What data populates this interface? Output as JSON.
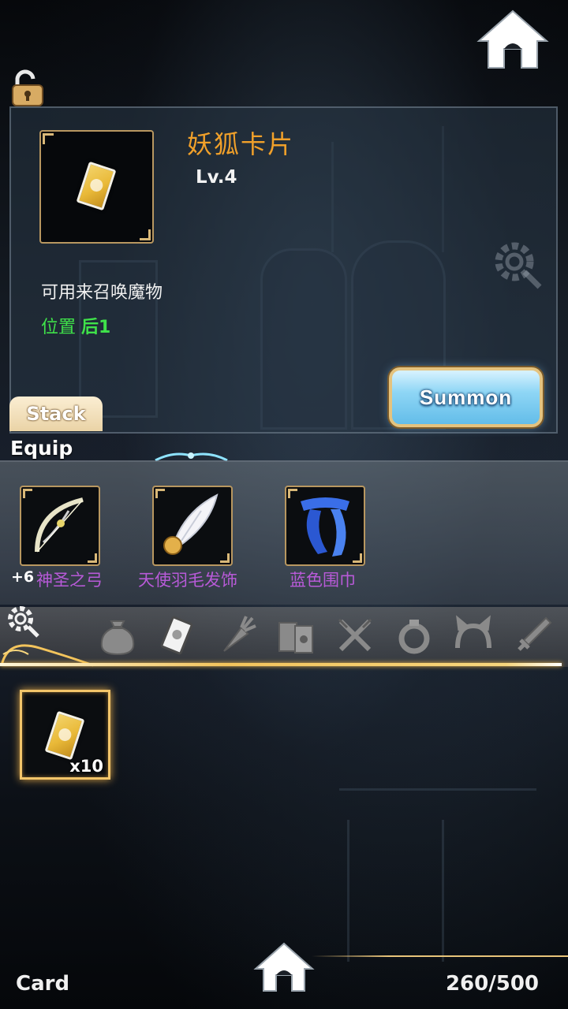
{
  "item": {
    "name": "妖狐卡片",
    "level": "Lv.4",
    "description": "可用来召唤魔物",
    "position_label": "位置",
    "position_value": "后1"
  },
  "buttons": {
    "summon_label": "Summon",
    "stack_label": "Stack"
  },
  "equip": {
    "label": "Equip",
    "slots": [
      {
        "plus": "+6",
        "name": "神圣之弓",
        "icon": "bow-icon"
      },
      {
        "name": "天使羽毛发饰",
        "icon": "feather-icon"
      },
      {
        "name": "蓝色围巾",
        "icon": "scarf-icon"
      }
    ]
  },
  "categories": [
    {
      "icon": "bag-icon"
    },
    {
      "icon": "card-icon",
      "active": true
    },
    {
      "icon": "carrot-icon"
    },
    {
      "icon": "books-icon"
    },
    {
      "icon": "utensils-icon"
    },
    {
      "icon": "ring-icon"
    },
    {
      "icon": "headband-icon"
    },
    {
      "icon": "sword-icon"
    }
  ],
  "inventory": [
    {
      "icon": "card-icon",
      "count": "x10",
      "selected": true
    }
  ],
  "footer": {
    "tab_label": "Card",
    "capacity": "260/500"
  },
  "colors": {
    "item_name": "#f0a02a",
    "position_text": "#3fe24a",
    "equip_name": "#b85ad8",
    "gold_frame": "#f3c56a"
  }
}
